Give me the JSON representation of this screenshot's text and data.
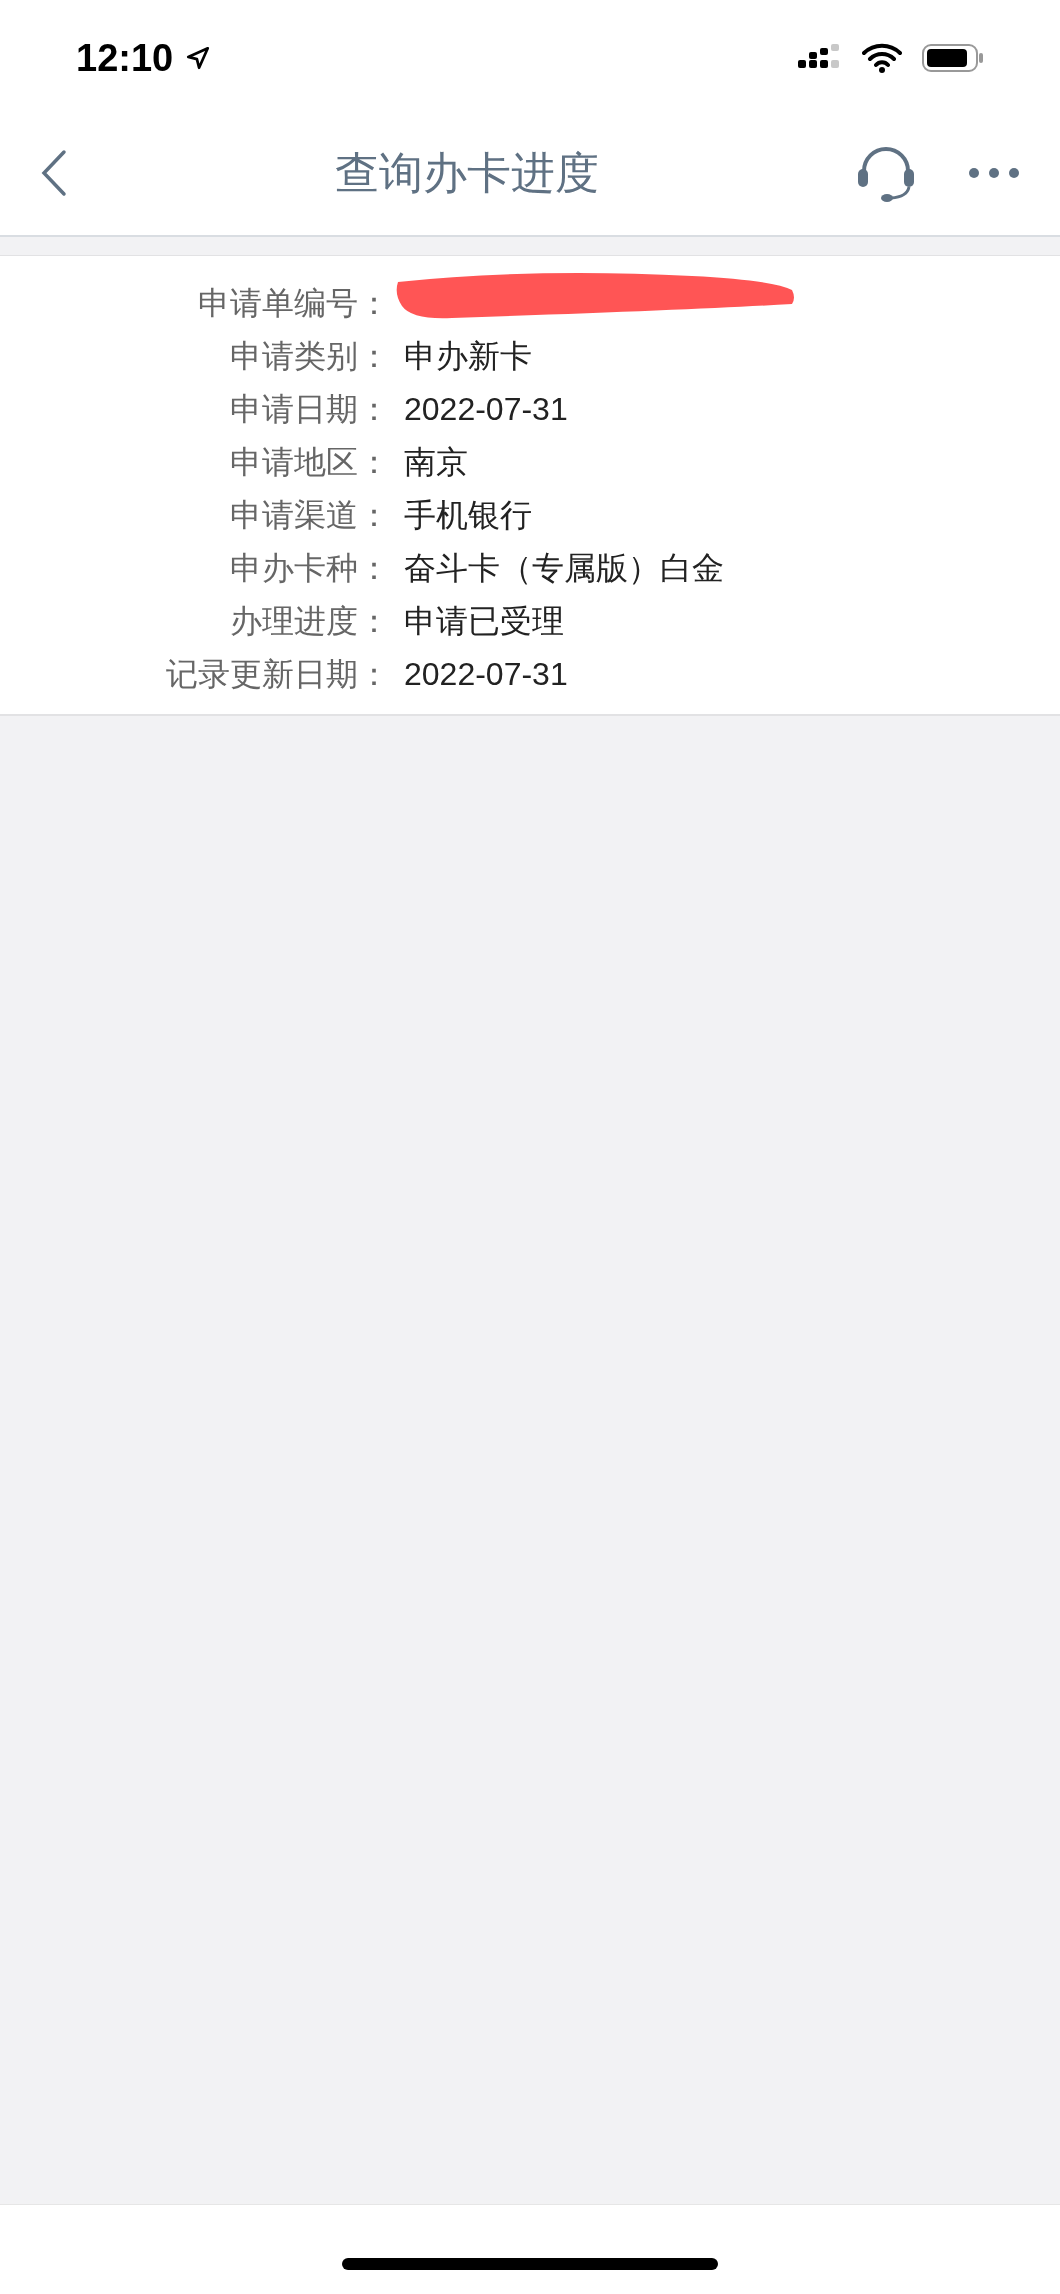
{
  "status_bar": {
    "time": "12:10"
  },
  "nav": {
    "title": "查询办卡进度"
  },
  "details": [
    {
      "label": "申请单编号：",
      "redacted": true
    },
    {
      "label": "申请类别：",
      "value": "申办新卡",
      "redacted": false
    },
    {
      "label": "申请日期：",
      "value": "2022-07-31",
      "redacted": false
    },
    {
      "label": "申请地区：",
      "value": "南京",
      "redacted": false
    },
    {
      "label": "申请渠道：",
      "value": "手机银行",
      "redacted": false
    },
    {
      "label": "申办卡种：",
      "value": "奋斗卡（专属版）白金",
      "redacted": false
    },
    {
      "label": "办理进度：",
      "value": "申请已受理",
      "redacted": false
    },
    {
      "label": "记录更新日期：",
      "value": "2022-07-31",
      "redacted": false
    }
  ]
}
